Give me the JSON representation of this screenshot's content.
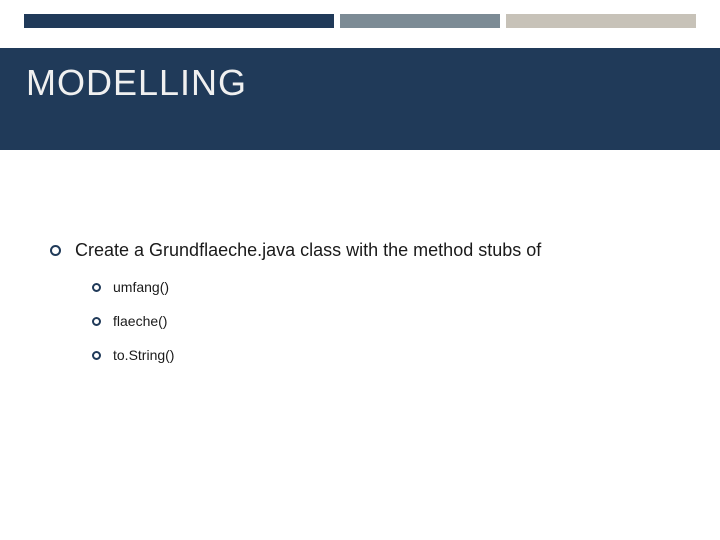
{
  "title": "MODELLING",
  "bullets": {
    "main": "Create a Grundflaeche.java class with the method stubs of",
    "subs": [
      "umfang()",
      "flaeche()",
      "to.String()"
    ]
  }
}
